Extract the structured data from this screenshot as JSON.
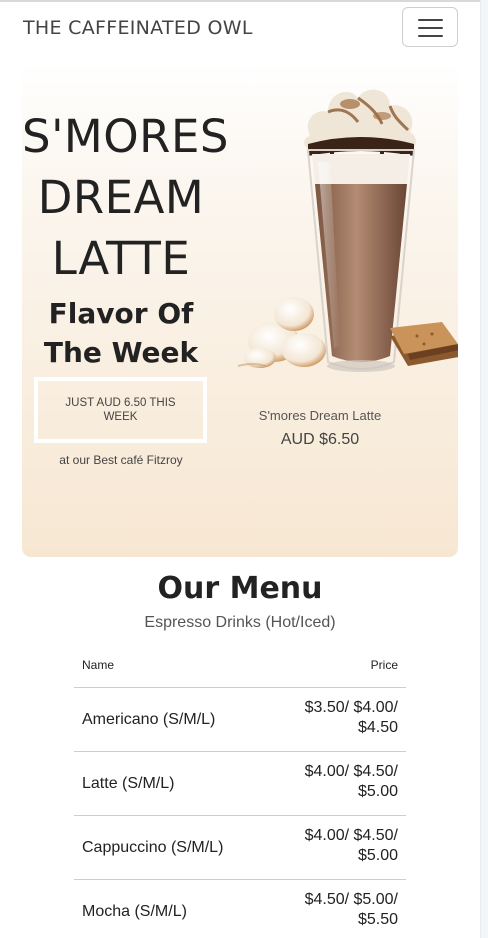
{
  "navbar": {
    "brand": "THE CAFFEINATED OWL",
    "toggle_icon": "hamburger-icon"
  },
  "hero": {
    "title_lines": [
      "S'MORES",
      "DREAM",
      "LATTE"
    ],
    "subtitle_lines": [
      "Flavor Of",
      "The Week"
    ],
    "cta_label": "JUST AUD 6.50 THIS WEEK",
    "location": "at our Best café Fitzroy",
    "product": {
      "image": "smores-latte-glass-image",
      "name": "S'mores Dream Latte",
      "price": "AUD $6.50"
    },
    "colors": {
      "gradient_top": "#ffffff",
      "gradient_bottom": "#f7e7d2"
    }
  },
  "menu": {
    "title": "Our Menu",
    "subtitle": "Espresso Drinks (Hot/Iced)",
    "columns": {
      "name": "Name",
      "price": "Price"
    },
    "rows": [
      {
        "name": "Americano (S/M/L)",
        "price": "$3.50/ $4.00/ $4.50"
      },
      {
        "name": "Latte (S/M/L)",
        "price": "$4.00/ $4.50/ $5.00"
      },
      {
        "name": "Cappuccino (S/M/L)",
        "price": "$4.00/ $4.50/ $5.00"
      },
      {
        "name": "Mocha (S/M/L)",
        "price": "$4.50/ $5.00/ $5.50"
      }
    ],
    "colors": {
      "divider": "#f0c69d"
    }
  }
}
